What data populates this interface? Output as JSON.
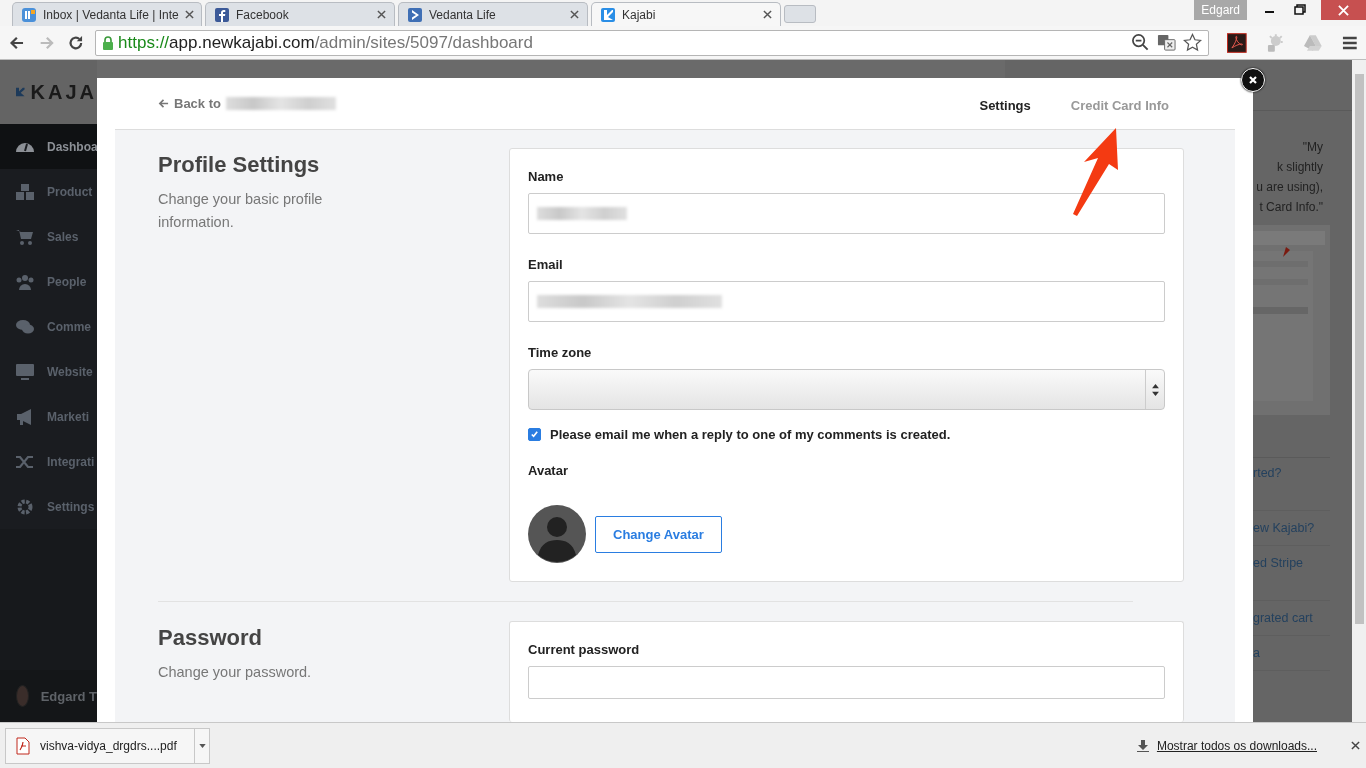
{
  "browser": {
    "tabs": [
      {
        "title": "Inbox | Vedanta Life | Inte",
        "selected": false
      },
      {
        "title": "Facebook",
        "selected": false
      },
      {
        "title": "Vedanta Life",
        "selected": false
      },
      {
        "title": "Kajabi",
        "selected": true
      }
    ],
    "profile": "Edgard",
    "url": {
      "scheme": "https://",
      "host": "app.newkajabi.com",
      "path": "/admin/sites/5097/dashboard"
    }
  },
  "sidebar": {
    "logo": "KAJA",
    "items": [
      {
        "label": "Dashboa",
        "selected": true
      },
      {
        "label": "Product",
        "selected": false
      },
      {
        "label": "Sales",
        "selected": false
      },
      {
        "label": "People",
        "selected": false
      },
      {
        "label": "Comme",
        "selected": false
      },
      {
        "label": "Website",
        "selected": false
      },
      {
        "label": "Marketi",
        "selected": false
      },
      {
        "label": "Integrati",
        "selected": false
      },
      {
        "label": "Settings",
        "selected": false
      }
    ],
    "user": "Edgard T"
  },
  "help_panel": {
    "quote_lines": [
      "\"My",
      "k slightly",
      "u are using),",
      "t Card Info.\""
    ],
    "links": [
      "rted?",
      "ew Kajabi?",
      "ed Stripe",
      "grated cart",
      "a"
    ]
  },
  "modal": {
    "back_link": {
      "label": "Back to",
      "redacted": true
    },
    "nav": [
      {
        "label": "Settings",
        "selected": true
      },
      {
        "label": "Credit Card Info",
        "selected": false
      }
    ],
    "profile": {
      "title": "Profile Settings",
      "description": "Change your basic profile information.",
      "fields": [
        {
          "label": "Name",
          "kind": "text",
          "redacted": true
        },
        {
          "label": "Email",
          "kind": "text",
          "redacted": true
        },
        {
          "label": "Time zone",
          "kind": "select",
          "redacted": false
        }
      ],
      "checkbox": {
        "label": "Please email me when a reply to one of my comments is created.",
        "checked": true
      },
      "avatar_label": "Avatar",
      "avatar_button": "Change Avatar"
    },
    "password": {
      "title": "Password",
      "description": "Change your password.",
      "fields": [
        {
          "label": "Current password",
          "kind": "text",
          "redacted": false
        }
      ]
    }
  },
  "downloads": {
    "file": "vishva-vidya_drgdrs....pdf",
    "show_all": "Mostrar todos os downloads..."
  }
}
